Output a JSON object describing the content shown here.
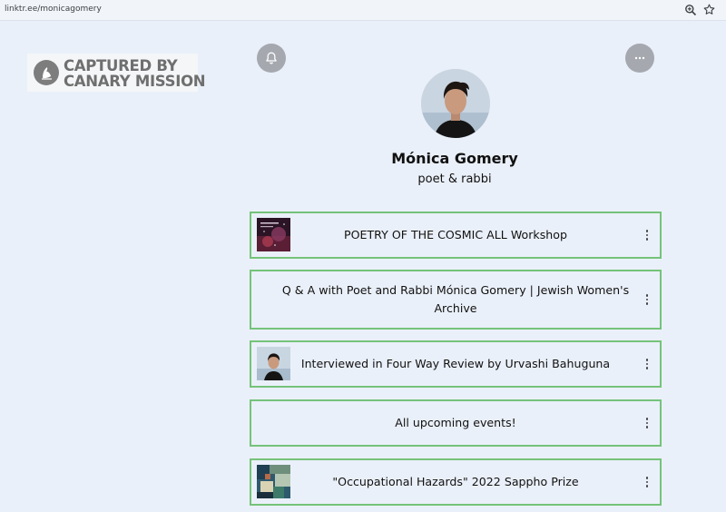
{
  "browser": {
    "url": "linktr.ee/monicagomery",
    "icons": [
      "zoom-icon",
      "star-icon"
    ]
  },
  "watermark": {
    "line1": "CAPTURED BY",
    "line2": "CANARY MISSION",
    "icon": "bird-icon"
  },
  "header": {
    "bell_icon": "bell-icon",
    "more_icon": "more-horizontal-icon"
  },
  "profile": {
    "name": "Mónica Gomery",
    "bio": "poet & rabbi"
  },
  "links": [
    {
      "label": "POETRY OF THE COSMIC ALL Workshop",
      "thumbnail": "cosmic-thumbnail"
    },
    {
      "label": "Q & A with Poet and Rabbi Mónica Gomery | Jewish Women's Archive",
      "thumbnail": null
    },
    {
      "label": "Interviewed in Four Way Review by Urvashi Bahuguna",
      "thumbnail": "portrait-thumbnail"
    },
    {
      "label": "All upcoming events!",
      "thumbnail": null
    },
    {
      "label": "\"Occupational Hazards\" 2022 Sappho Prize",
      "thumbnail": "painting-thumbnail"
    }
  ],
  "colors": {
    "page_background": "#eaf0f9",
    "card_border": "#74c37a",
    "circle_button": "#a5a8ae",
    "watermark_text": "#6f6f6f"
  }
}
